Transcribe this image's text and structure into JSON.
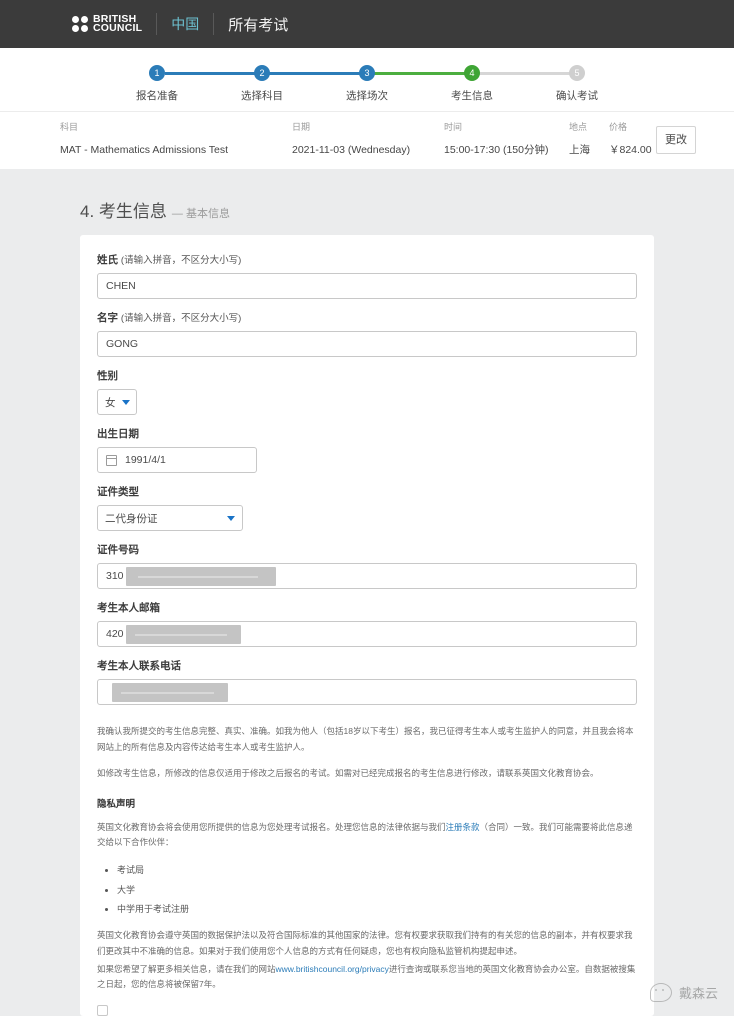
{
  "topnav": {
    "logo_line1": "BRITISH",
    "logo_line2": "COUNCIL",
    "region": "中国",
    "all_exams": "所有考试",
    "logo_icon": "four-dots-logo"
  },
  "stepper": {
    "steps": [
      {
        "number": "1",
        "label": "报名准备",
        "state": "done"
      },
      {
        "number": "2",
        "label": "选择科目",
        "state": "done"
      },
      {
        "number": "3",
        "label": "选择场次",
        "state": "done"
      },
      {
        "number": "4",
        "label": "考生信息",
        "state": "current"
      },
      {
        "number": "5",
        "label": "确认考试",
        "state": "upcoming"
      }
    ],
    "colors": {
      "done": "#2b7cb8",
      "current": "#3fa535",
      "upcoming": "#cfcfcf"
    }
  },
  "summary": {
    "headers": {
      "subject": "科目",
      "date": "日期",
      "time": "时间",
      "place": "地点",
      "price": "价格"
    },
    "row": {
      "subject": "MAT - Mathematics Admissions Test",
      "date": "2021-11-03 (Wednesday)",
      "time": "15:00-17:30 (150分钟)",
      "place": "上海",
      "price": "￥824.00"
    },
    "change_button": "更改"
  },
  "page": {
    "title": "4. 考生信息",
    "subtitle": "— 基本信息"
  },
  "form": {
    "surname": {
      "label": "姓氏",
      "hint": "(请输入拼音，不区分大小写)",
      "value": "CHEN"
    },
    "given_name": {
      "label": "名字",
      "hint": "(请输入拼音，不区分大小写)",
      "value": "GONG"
    },
    "gender": {
      "label": "性别",
      "value": "女",
      "icon": "chevron-down-icon"
    },
    "birth_date": {
      "label": "出生日期",
      "value": "1991/4/1",
      "icon": "calendar-icon"
    },
    "id_type": {
      "label": "证件类型",
      "value": "二代身份证",
      "icon": "chevron-down-icon"
    },
    "id_number": {
      "label": "证件号码",
      "value": "310"
    },
    "email": {
      "label": "考生本人邮箱",
      "value": "420"
    },
    "phone": {
      "label": "考生本人联系电话",
      "value": ""
    }
  },
  "legal": {
    "para1": "我确认我所提交的考生信息完整、真实、准确。如我为他人（包括18岁以下考生）报名，我已征得考生本人或考生监护人的同意，并且我会将本网站上的所有信息及内容传达给考生本人或考生监护人。",
    "para2": "如修改考生信息，所修改的信息仅适用于修改之后报名的考试。如需对已经完成报名的考生信息进行修改，请联系英国文化教育协会。",
    "privacy_heading": "隐私声明",
    "privacy_intro_a": "英国文化教育协会将会使用您所提供的信息为您处理考试报名。处理您信息的法律依据与我们",
    "privacy_link": "注册条款",
    "privacy_intro_b": "（合同）一致。我们可能需要将此信息递交给以下合作伙伴：",
    "partners": [
      "考试局",
      "大学",
      "中学用于考试注册"
    ],
    "para3": "英国文化教育协会遵守英国的数据保护法以及符合国际标准的其他国家的法律。您有权要求获取我们持有的有关您的信息的副本，并有权要求我们更改其中不准确的信息。如果对于我们使用您个人信息的方式有任何疑虑，您也有权向隐私监管机构提起申述。",
    "para4_a": "如果您希望了解更多相关信息，请在我们的网站",
    "para4_link": "www.britishcouncil.org/privacy",
    "para4_b": "进行查询或联系您当地的英国文化教育协会办公室。自数据被搜集之日起，您的信息将被保留7年。"
  },
  "watermark": {
    "icon": "wechat-icon",
    "label": "戴森云"
  }
}
